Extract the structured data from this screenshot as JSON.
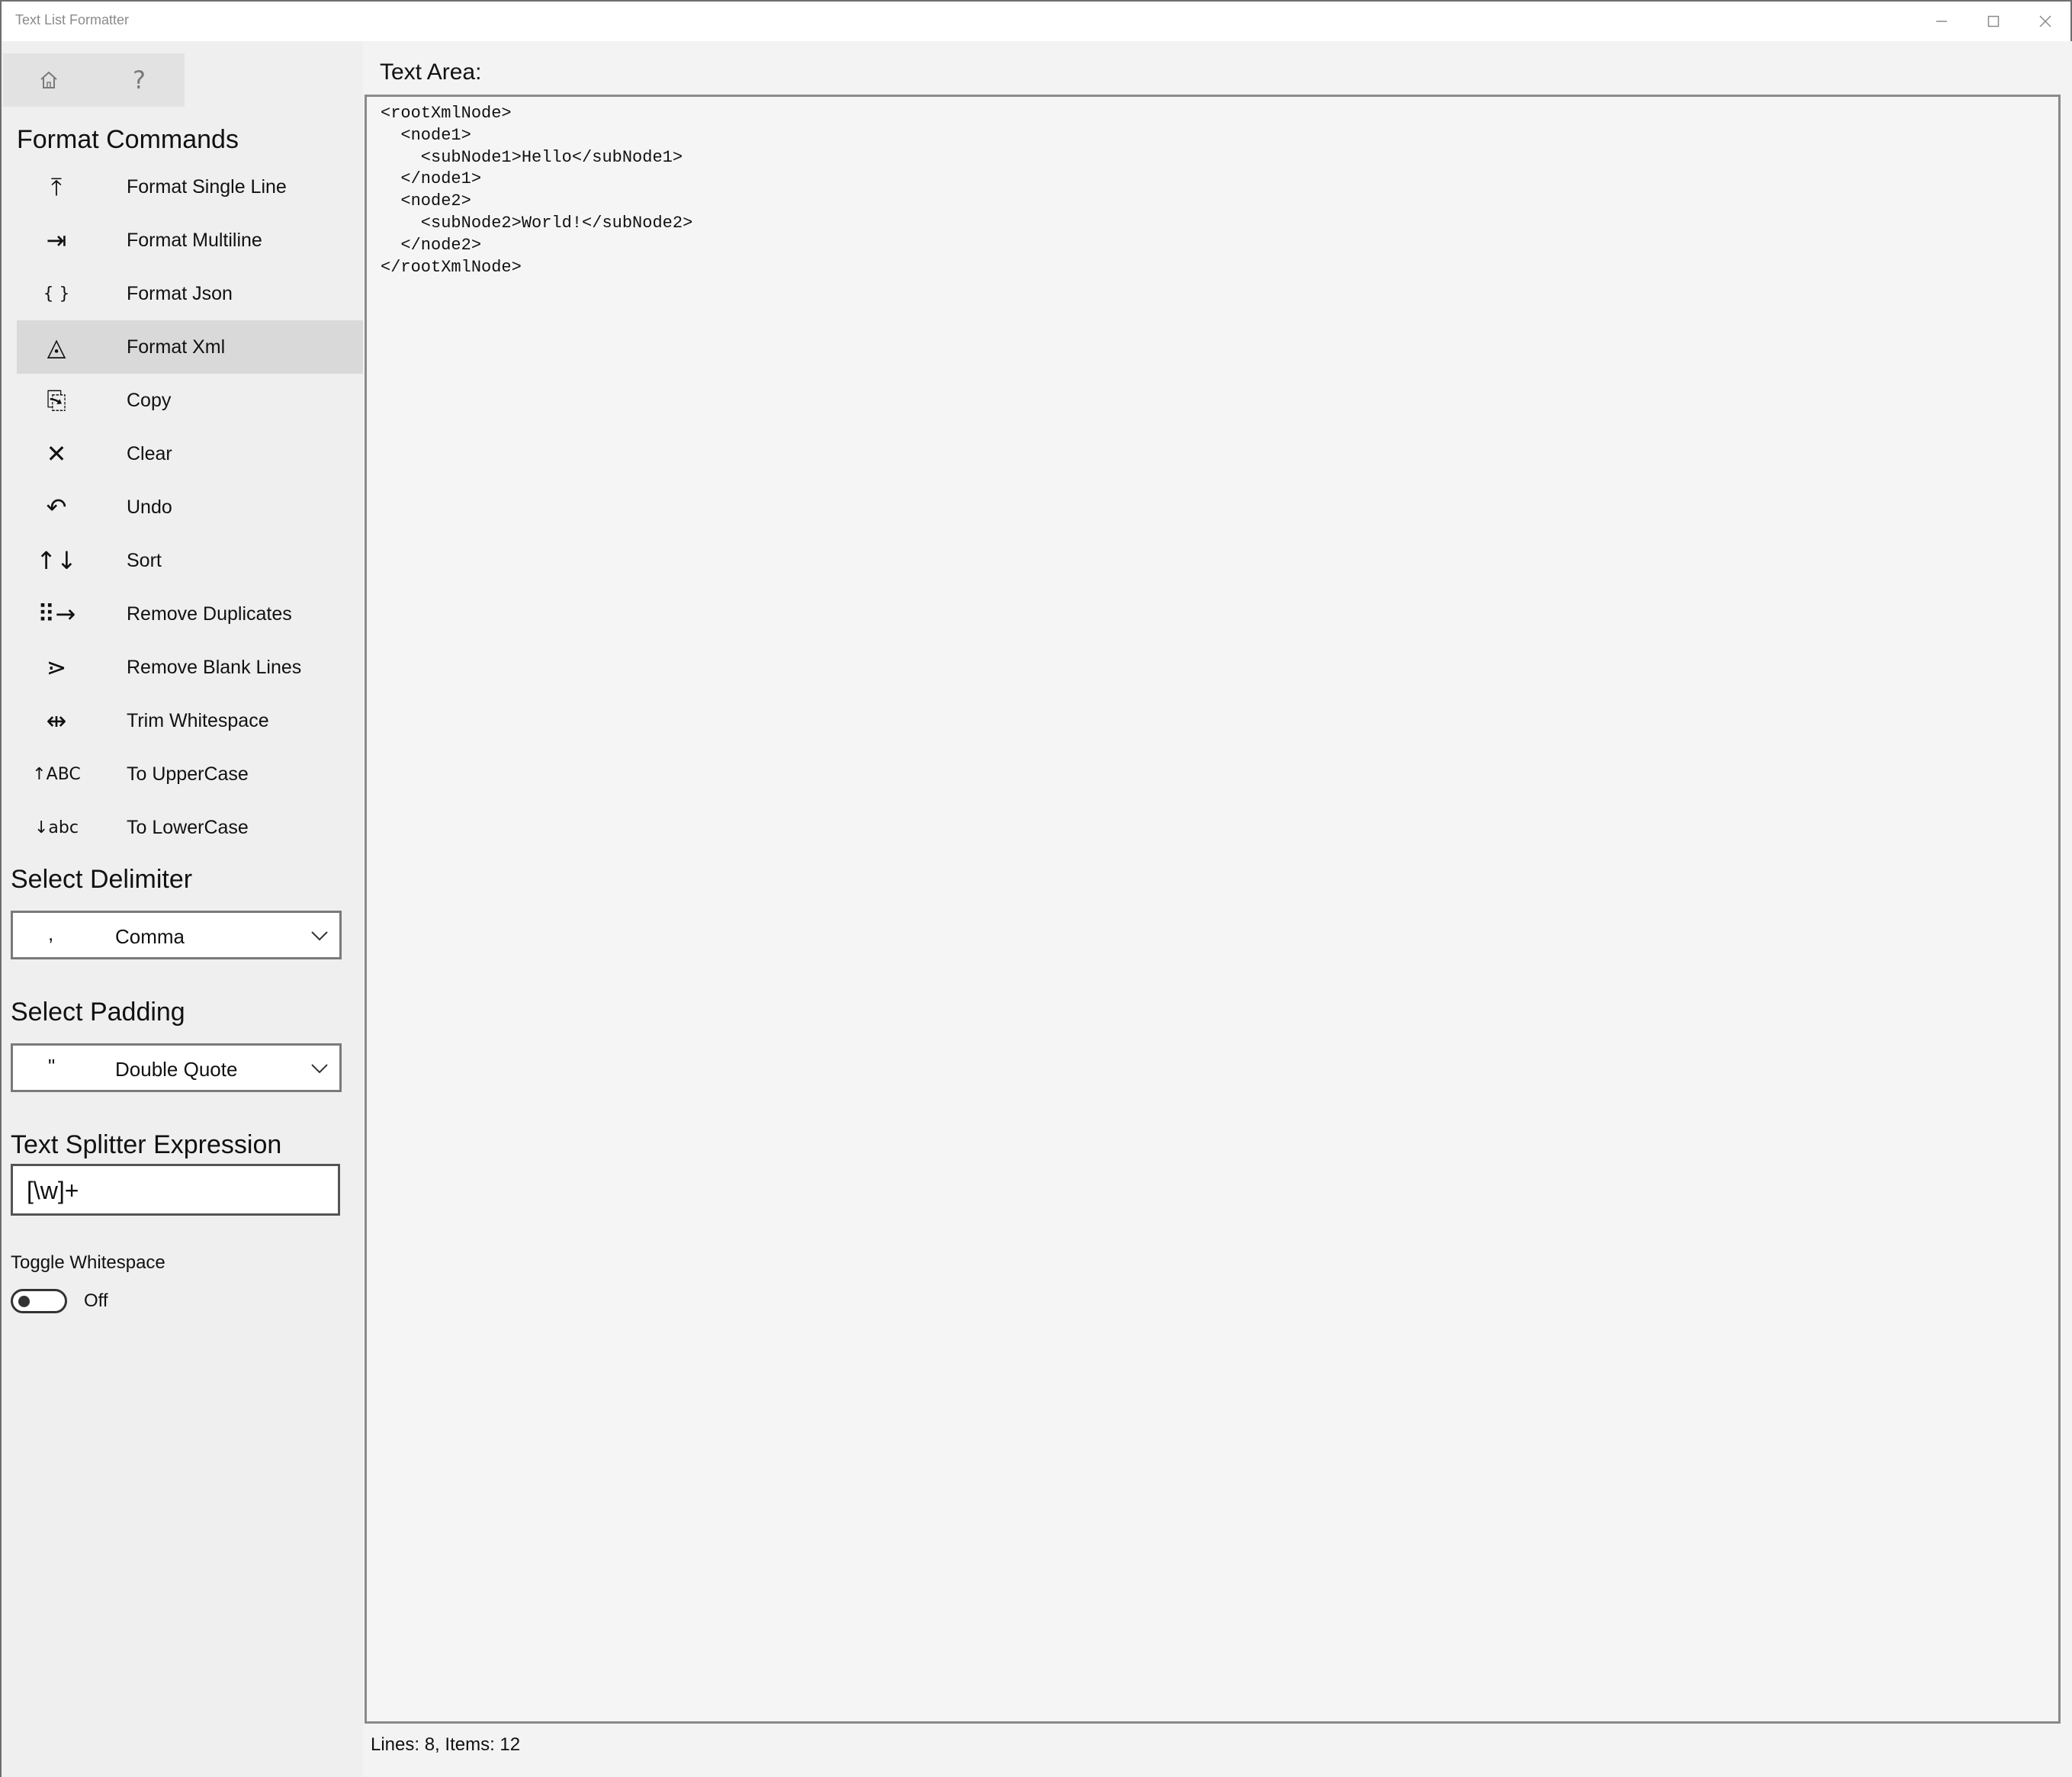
{
  "window": {
    "title": "Text List Formatter",
    "minimize_icon": "minimize-icon",
    "maximize_icon": "maximize-icon",
    "close_icon": "close-icon"
  },
  "sidebar": {
    "top_buttons": [
      {
        "icon": "home-icon",
        "glyph": "⌂"
      },
      {
        "icon": "help-icon",
        "glyph": "?"
      }
    ],
    "format_commands_title": "Format Commands",
    "commands": [
      {
        "label": "Format Single Line",
        "icon": "format-single-line-icon",
        "glyph": "⤒",
        "selected": false
      },
      {
        "label": "Format Multiline",
        "icon": "format-multiline-icon",
        "glyph": "⇥",
        "selected": false
      },
      {
        "label": "Format Json",
        "icon": "braces-icon",
        "glyph": "{ }",
        "selected": false
      },
      {
        "label": "Format Xml",
        "icon": "xml-triangle-icon",
        "glyph": "◬",
        "selected": true
      },
      {
        "label": "Copy",
        "icon": "copy-icon",
        "glyph": "⎘",
        "selected": false
      },
      {
        "label": "Clear",
        "icon": "clear-icon",
        "glyph": "✕",
        "selected": false
      },
      {
        "label": "Undo",
        "icon": "undo-icon",
        "glyph": "↶",
        "selected": false
      },
      {
        "label": "Sort",
        "icon": "sort-icon",
        "glyph": "↑↓",
        "selected": false
      },
      {
        "label": "Remove Duplicates",
        "icon": "remove-duplicates-icon",
        "glyph": "⠿→",
        "selected": false
      },
      {
        "label": "Remove Blank Lines",
        "icon": "remove-blank-lines-icon",
        "glyph": "⋗",
        "selected": false
      },
      {
        "label": "Trim Whitespace",
        "icon": "trim-whitespace-icon",
        "glyph": "⇹",
        "selected": false
      },
      {
        "label": "To UpperCase",
        "icon": "uppercase-icon",
        "glyph": "↑ABC",
        "selected": false
      },
      {
        "label": "To LowerCase",
        "icon": "lowercase-icon",
        "glyph": "↓abc",
        "selected": false
      }
    ],
    "delimiter": {
      "title": "Select Delimiter",
      "symbol": ",",
      "value": "Comma"
    },
    "padding": {
      "title": "Select Padding",
      "symbol": "\"",
      "value": "Double Quote"
    },
    "splitter": {
      "title": "Text Splitter Expression",
      "value": "[\\w]+"
    },
    "toggle": {
      "label": "Toggle Whitespace",
      "state": "Off"
    }
  },
  "main": {
    "area_label": "Text Area:",
    "content": "<rootXmlNode>\n  <node1>\n    <subNode1>Hello</subNode1>\n  </node1>\n  <node2>\n    <subNode2>World!</subNode2>\n  </node2>\n</rootXmlNode>",
    "status": "Lines: 8, Items: 12"
  }
}
